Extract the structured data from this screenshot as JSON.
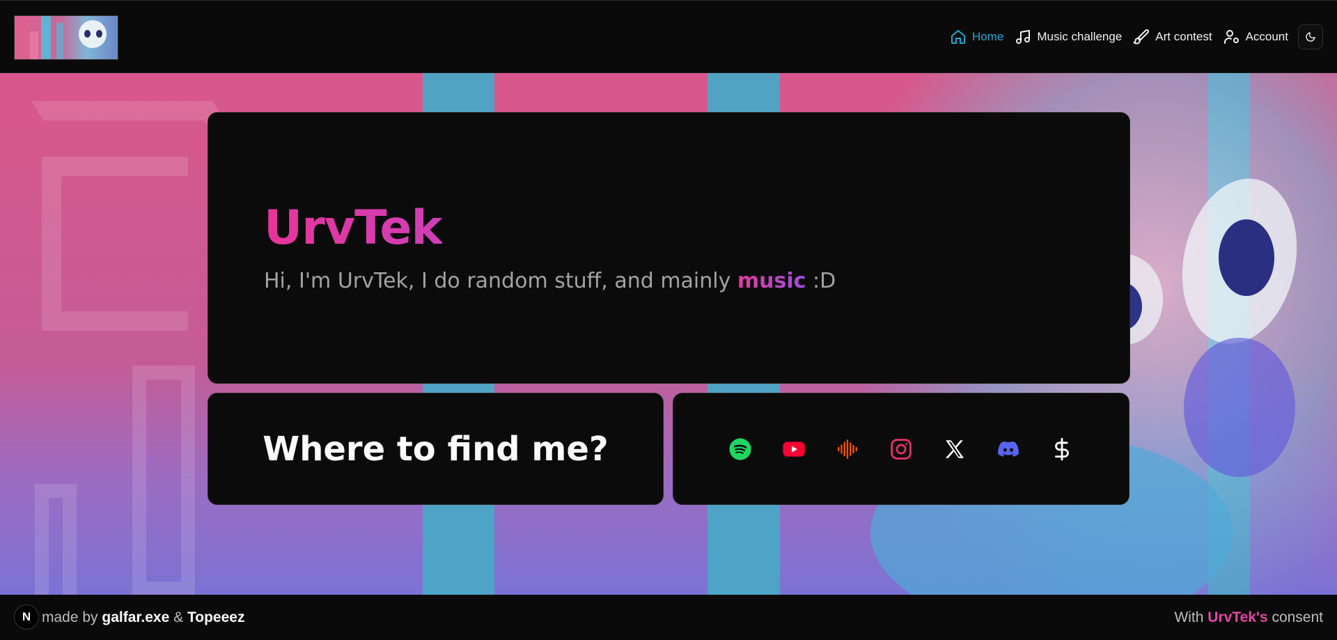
{
  "header": {
    "nav": [
      {
        "label": "Home",
        "icon": "home-icon",
        "active": true
      },
      {
        "label": "Music challenge",
        "icon": "music-note-icon"
      },
      {
        "label": "Art contest",
        "icon": "paintbrush-icon"
      },
      {
        "label": "Account",
        "icon": "user-settings-icon"
      }
    ],
    "theme_toggle_icon": "moon-icon",
    "accent": "#1fa6d6"
  },
  "hero": {
    "title": "UrvTek",
    "subtitle_before": "Hi, I'm UrvTek, I do random stuff, and mainly ",
    "subtitle_highlight": "music",
    "subtitle_after": " :D",
    "title_color": "#e6349a"
  },
  "find": {
    "title": "Where to find me?"
  },
  "socials": [
    {
      "name": "Spotify",
      "icon": "spotify-icon",
      "color": "#1ed760"
    },
    {
      "name": "YouTube",
      "icon": "youtube-icon",
      "color": "#ff0033"
    },
    {
      "name": "SoundCloud",
      "icon": "soundwave-icon",
      "color": "#ff5500"
    },
    {
      "name": "Instagram",
      "icon": "instagram-icon",
      "color": "#e1306c"
    },
    {
      "name": "X",
      "icon": "x-icon",
      "color": "#ffffff"
    },
    {
      "name": "Discord",
      "icon": "discord-icon",
      "color": "#5865f2"
    },
    {
      "name": "Donate",
      "icon": "dollar-icon",
      "color": "#ffffff"
    }
  ],
  "footer": {
    "badge": "N",
    "made_by_prefix": "made by ",
    "author1": "galfar.exe",
    "amp": " & ",
    "author2": "Topeeez",
    "consent_prefix": "With ",
    "consent_name": "UrvTek's",
    "consent_suffix": " consent"
  }
}
